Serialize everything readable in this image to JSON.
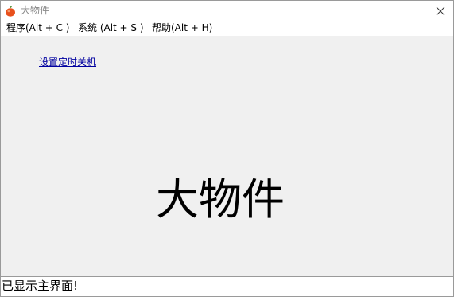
{
  "window": {
    "title": "大物件",
    "icon": "apple-icon",
    "close_icon": "close-icon"
  },
  "menu": {
    "items": [
      {
        "label": "程序(Alt + C )"
      },
      {
        "label": "系统 (Alt + S )"
      },
      {
        "label": "帮助(Alt + H)"
      }
    ]
  },
  "main": {
    "link_label": "设置定时关机",
    "headline": "大物件"
  },
  "status": {
    "text": "已显示主界面!"
  },
  "colors": {
    "window_bg": "#f0f0f0",
    "link": "#0000a0",
    "title_text": "#8a8a8a"
  }
}
